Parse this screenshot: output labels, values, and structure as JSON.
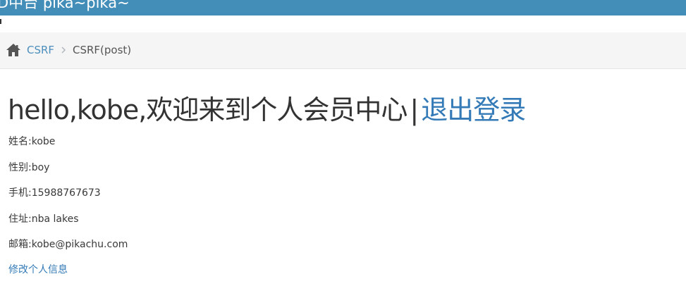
{
  "topbar": {
    "title": "D中台 pika~pika~"
  },
  "breadcrumb": {
    "home_icon": "home-icon",
    "link_label": "CSRF",
    "separator_icon": "chevron-right-icon",
    "active_label": "CSRF(post)"
  },
  "main": {
    "greeting": "hello,kobe,欢迎来到个人会员中心",
    "separator": "|",
    "logout_label": "退出登录",
    "info": {
      "name": "姓名:kobe",
      "gender": "性别:boy",
      "phone": "手机:15988767673",
      "address": "住址:nba lakes",
      "email": "邮箱:kobe@pikachu.com"
    },
    "edit_link": "修改个人信息"
  },
  "colors": {
    "topbar": "#438eb9",
    "link": "#337ab7",
    "breadcrumb_bg": "#f5f5f5"
  }
}
